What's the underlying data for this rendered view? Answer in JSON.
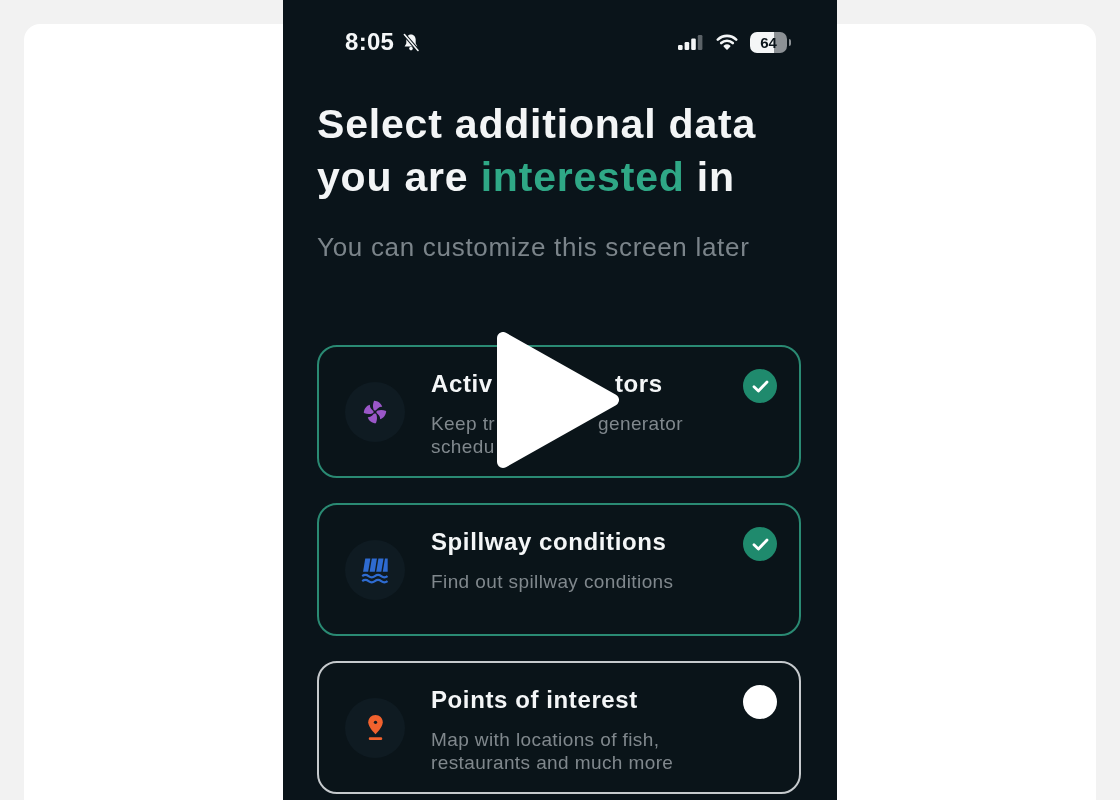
{
  "status_bar": {
    "time": "8:05",
    "battery": "64"
  },
  "heading": [
    {
      "text": "Select additional data you are ",
      "highlight": false
    },
    {
      "text": "interested",
      "highlight": true
    },
    {
      "text": " in",
      "highlight": false
    }
  ],
  "subtitle": "You can customize this screen later",
  "cards": [
    {
      "title": [
        "Activ",
        "tors"
      ],
      "description": [
        [
          "Keep tr",
          "generator"
        ],
        [
          "schedu"
        ]
      ],
      "checked": true
    },
    {
      "title": [
        "Spillway conditions"
      ],
      "description": [
        [
          "Find out spillway conditions"
        ]
      ],
      "checked": true
    },
    {
      "title": [
        "Points of interest"
      ],
      "description": [
        [
          "Map with locations of fish, restaurants and much more"
        ]
      ],
      "checked": false
    }
  ]
}
